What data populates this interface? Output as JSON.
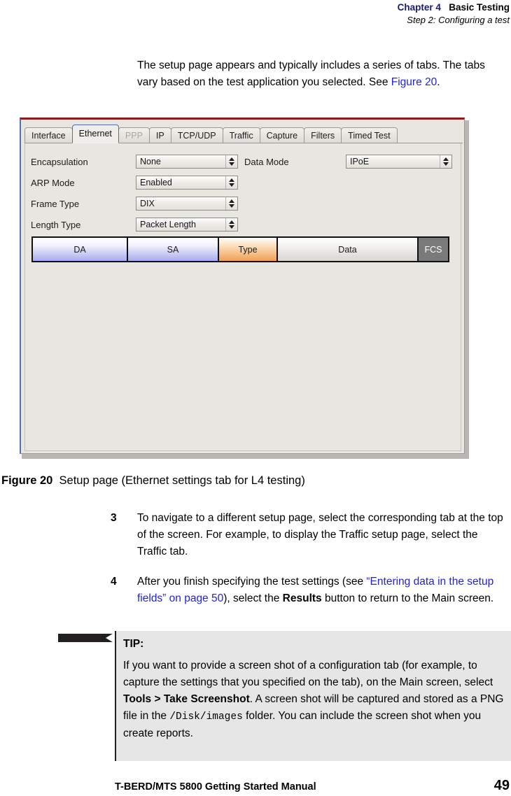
{
  "header": {
    "chapter_label": "Chapter 4",
    "chapter_title": "Basic Testing",
    "section": "Step 2: Configuring a test"
  },
  "intro": {
    "text_before": "The setup page appears and typically includes a series of tabs. The tabs vary based on the test application you selected. See ",
    "link": "Figure 20",
    "text_after": "."
  },
  "screenshot": {
    "tabs": [
      {
        "label": "Interface",
        "state": "normal"
      },
      {
        "label": "Ethernet",
        "state": "active"
      },
      {
        "label": "PPP",
        "state": "disabled"
      },
      {
        "label": "IP",
        "state": "normal"
      },
      {
        "label": "TCP/UDP",
        "state": "normal"
      },
      {
        "label": "Traffic",
        "state": "normal"
      },
      {
        "label": "Capture",
        "state": "normal"
      },
      {
        "label": "Filters",
        "state": "normal"
      },
      {
        "label": "Timed Test",
        "state": "normal"
      }
    ],
    "fields": [
      {
        "label": "Encapsulation",
        "value": "None"
      },
      {
        "label": "ARP Mode",
        "value": "Enabled"
      },
      {
        "label": "Frame Type",
        "value": "DIX"
      },
      {
        "label": "Length Type",
        "value": "Packet Length"
      }
    ],
    "data_mode": {
      "label": "Data Mode",
      "value": "IPoE"
    },
    "frame_diagram": {
      "segments": [
        {
          "name": "DA",
          "color": "#aaaaf0"
        },
        {
          "name": "SA",
          "color": "#aaaaf0"
        },
        {
          "name": "Type",
          "color": "#f0a055"
        },
        {
          "name": "Data",
          "color": "#d8d6d2"
        },
        {
          "name": "FCS",
          "color": "#7a7a7a"
        }
      ]
    },
    "accent_top_color": "#8d1b1b",
    "accent_left_color": "#5070b8"
  },
  "figure": {
    "number": "Figure 20",
    "caption": "Setup page (Ethernet settings tab for L4 testing)"
  },
  "steps": [
    {
      "number": "3",
      "text": "To navigate to a different setup page, select the corresponding tab at the top of the screen. For example, to display the Traffic setup page, select the Traffic tab."
    },
    {
      "number": "4",
      "text_1": "After you finish specifying the test settings (see ",
      "link": "“Entering data in the setup fields” on page 50",
      "text_2": "), select the ",
      "bold": "Results",
      "text_3": " button to return to the Main screen."
    }
  ],
  "tip": {
    "title": "TIP:",
    "text_1": "If you want to provide a screen shot of a configuration tab (for example, to capture the settings that you specified on the tab), on the Main screen, select ",
    "bold_menu": "Tools > Take Screenshot",
    "text_2": ". A screen shot will be captured and stored as a PNG file in the ",
    "mono_path": "/Disk/images",
    "text_3": " folder. You can include the screen shot when you create reports."
  },
  "footer": {
    "title": "T-BERD/MTS 5800 Getting Started Manual",
    "page": "49"
  }
}
